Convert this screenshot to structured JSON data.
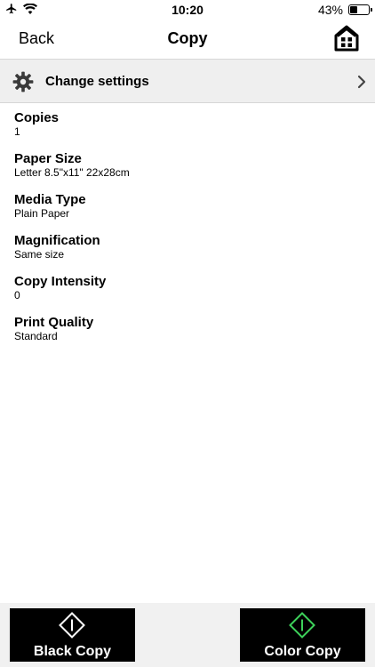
{
  "status_bar": {
    "time": "10:20",
    "battery_percent": "43%",
    "battery_level": 0.43
  },
  "nav": {
    "back_label": "Back",
    "title": "Copy",
    "home_icon": "home-icon"
  },
  "settings_row": {
    "label": "Change settings",
    "icon": "gear-icon"
  },
  "settings": [
    {
      "title": "Copies",
      "value": "1"
    },
    {
      "title": "Paper Size",
      "value": "Letter 8.5\"x11\" 22x28cm"
    },
    {
      "title": "Media Type",
      "value": "Plain Paper"
    },
    {
      "title": "Magnification",
      "value": "Same size"
    },
    {
      "title": "Copy Intensity",
      "value": "0"
    },
    {
      "title": "Print Quality",
      "value": "Standard"
    }
  ],
  "buttons": {
    "black_copy": {
      "label": "Black Copy",
      "icon_color": "#ffffff"
    },
    "color_copy": {
      "label": "Color Copy",
      "icon_color": "#3dd15a"
    }
  }
}
